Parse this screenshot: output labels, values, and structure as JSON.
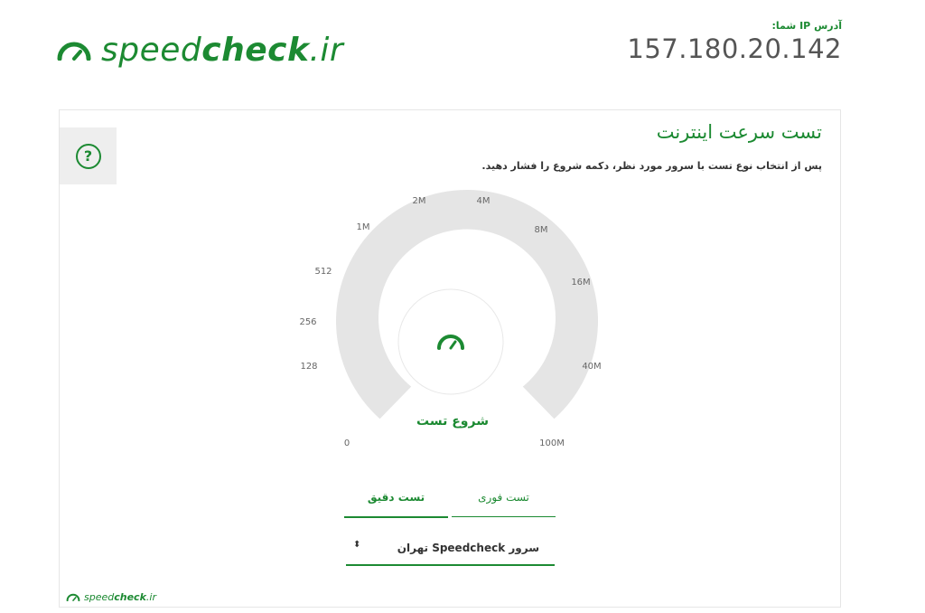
{
  "brand": {
    "name_light": "speed",
    "name_bold": "check",
    "name_suffix": ".ir",
    "color": "#1c8a32"
  },
  "ip": {
    "label": "آدرس IP شما:",
    "value": "157.180.20.142"
  },
  "panel": {
    "title": "تست سرعت اینترنت",
    "subtitle": "پس از انتخاب نوع تست با سرور مورد نظر، دکمه شروع را فشار دهید.",
    "help_icon": "question-circle-icon"
  },
  "gauge": {
    "ticks": [
      "0",
      "128",
      "256",
      "512",
      "1M",
      "2M",
      "4M",
      "8M",
      "16M",
      "40M",
      "100M"
    ],
    "start_label": "شروع تست",
    "center_icon": "speedometer-icon",
    "track_color": "#e5e5e5"
  },
  "tabs": [
    {
      "label": "تست دقیق",
      "active": true
    },
    {
      "label": "تست فوری",
      "active": false
    }
  ],
  "server": {
    "label": "سرور Speedcheck تهران",
    "icon": "updown-arrows-icon"
  }
}
